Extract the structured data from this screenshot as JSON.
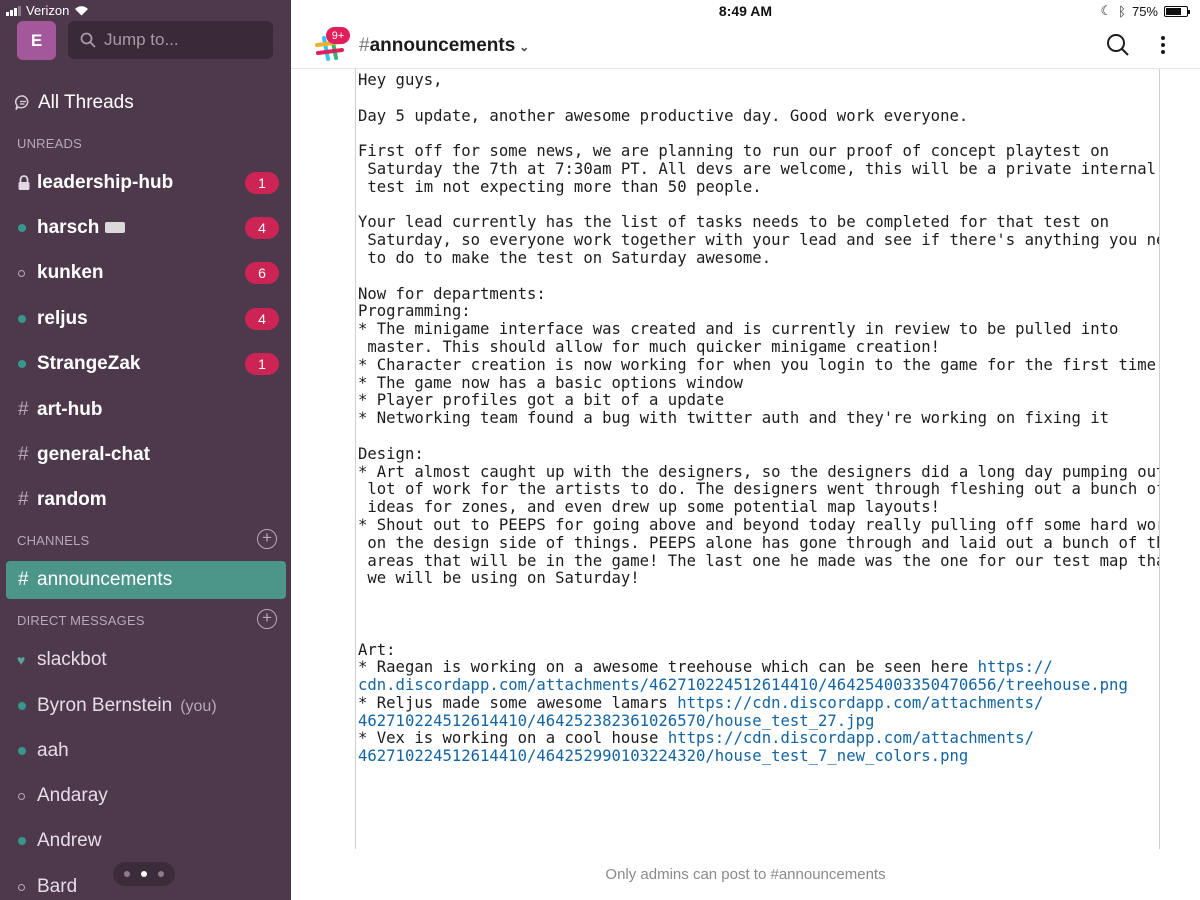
{
  "status": {
    "carrier": "Verizon",
    "time": "8:49 AM",
    "battery": "75%"
  },
  "workspace": {
    "initial": "E"
  },
  "search": {
    "placeholder": "Jump to..."
  },
  "sidebar": {
    "all_threads": "All Threads",
    "unreads_label": "UNREADS",
    "unreads": [
      {
        "name": "leadership-hub",
        "badge": "1"
      },
      {
        "name": "harsch",
        "badge": "4"
      },
      {
        "name": "kunken",
        "badge": "6"
      },
      {
        "name": "reljus",
        "badge": "4"
      },
      {
        "name": "StrangeZak",
        "badge": "1"
      },
      {
        "name": "art-hub"
      },
      {
        "name": "general-chat"
      },
      {
        "name": "random"
      }
    ],
    "channels_label": "CHANNELS",
    "channels": [
      {
        "name": "announcements"
      }
    ],
    "dms_label": "DIRECT MESSAGES",
    "dms": [
      {
        "name": "slackbot"
      },
      {
        "name": "Byron Bernstein",
        "suffix": "(you)"
      },
      {
        "name": "aah"
      },
      {
        "name": "Andaray"
      },
      {
        "name": "Andrew"
      },
      {
        "name": "Bard"
      }
    ]
  },
  "channel": {
    "notif_count": "9+",
    "hash": "#",
    "name": "announcements"
  },
  "message": {
    "l1": "Hey guys,",
    "l2": "Day 5 update, another awesome productive day. Good work everyone.",
    "l3": "First off for some news, we are planning to run our proof of concept playtest on",
    "l4": " Saturday the 7th at 7:30am PT. All devs are welcome, this will be a private internal",
    "l5": " test im not expecting more than 50 people.",
    "l6": "Your lead currently has the list of tasks needs to be completed for that test on",
    "l7": " Saturday, so everyone work together with your lead and see if there's anything you need",
    "l8": " to do to make the test on Saturday awesome.",
    "l9": "Now for departments:",
    "l10": "Programming:",
    "l11": "* The minigame interface was created and is currently in review to be pulled into",
    "l12": " master. This should allow for much quicker minigame creation!",
    "l13": "* Character creation is now working for when you login to the game for the first time",
    "l14": "* The game now has a basic options window",
    "l15": "* Player profiles got a bit of a update",
    "l16": "* Networking team found a bug with twitter auth and they're working on fixing it",
    "l17": "Design:",
    "l18": "* Art almost caught up with the designers, so the designers did a long day pumping out a",
    "l19": " lot of work for the artists to do. The designers went through fleshing out a bunch of",
    "l20": " ideas for zones, and even drew up some potential map layouts!",
    "l21": "* Shout out to PEEPS for going above and beyond today really pulling off some hard work",
    "l22": " on the design side of things. PEEPS alone has gone through and laid out a bunch of the",
    "l23": " areas that will be in the game! The last one he made was the one for our test map that",
    "l24": " we will be using on Saturday!",
    "l25": "Art:",
    "l26": "* Raegan is working on a awesome treehouse which can be seen here ",
    "link1a": "https://",
    "link1b": "cdn.discordapp.com/attachments/462710224512614410/464254003350470656/treehouse.png",
    "l27": "* Reljus made some awesome lamars ",
    "link2a": "https://cdn.discordapp.com/attachments/",
    "link2b": "462710224512614410/464252382361026570/house_test_27.jpg",
    "l28": "* Vex is working on a cool house ",
    "link3a": "https://cdn.discordapp.com/attachments/",
    "link3b": "462710224512614410/464252990103224320/house_test_7_new_colors.png"
  },
  "footer": {
    "note": "Only admins can post to #announcements"
  }
}
